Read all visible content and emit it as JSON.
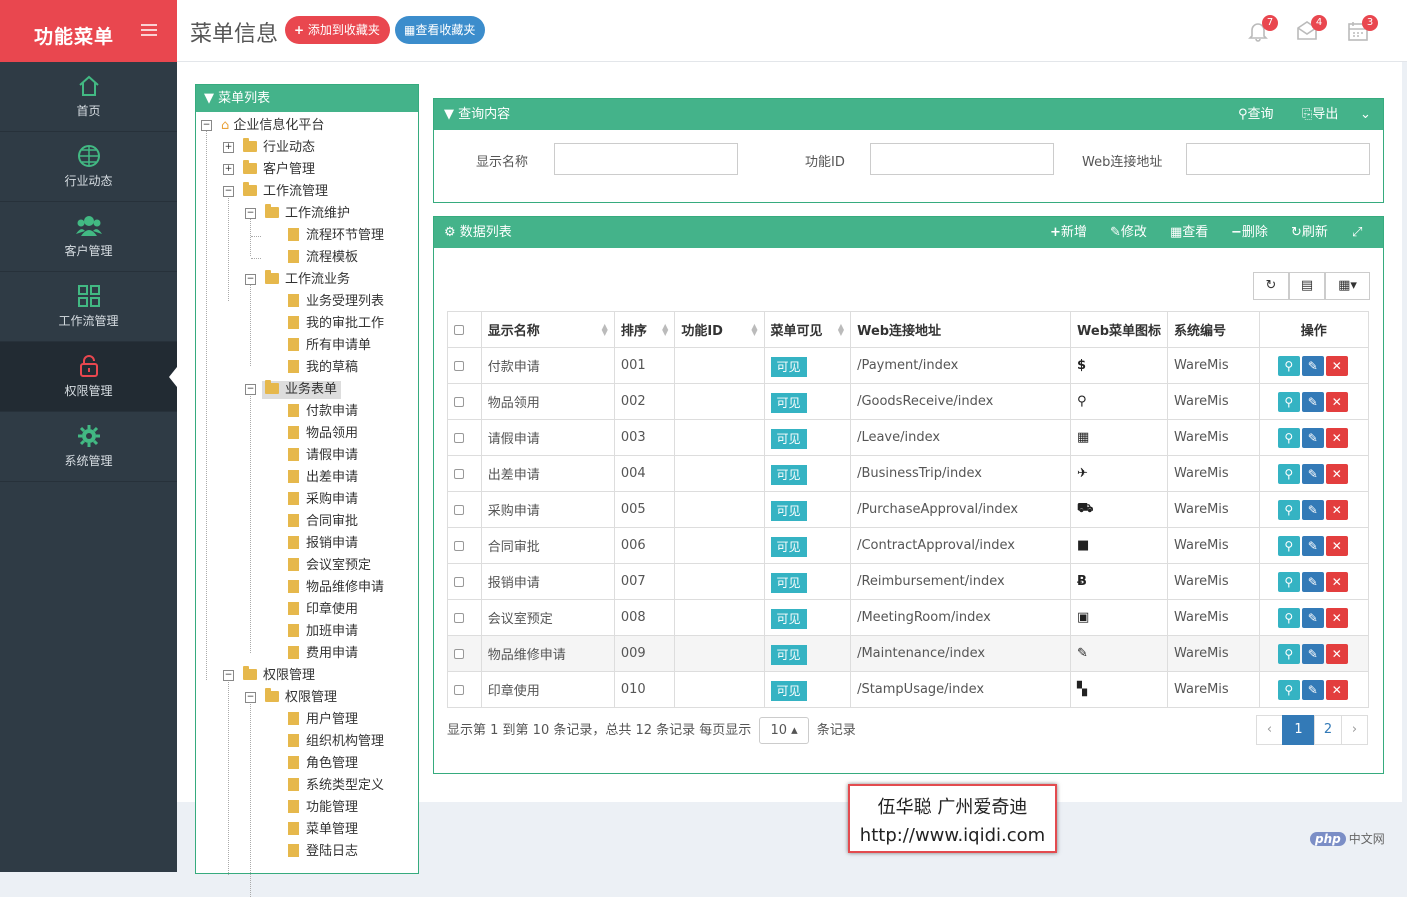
{
  "sidebar": {
    "logo": "功能菜单",
    "items": [
      {
        "label": "首页",
        "icon": "home-icon"
      },
      {
        "label": "行业动态",
        "icon": "globe-icon"
      },
      {
        "label": "客户管理",
        "icon": "users-icon"
      },
      {
        "label": "工作流管理",
        "icon": "grid-icon"
      },
      {
        "label": "权限管理",
        "icon": "lock-icon"
      },
      {
        "label": "系统管理",
        "icon": "gear-icon"
      }
    ]
  },
  "header": {
    "title": "菜单信息",
    "add_fav": "添加到收藏夹",
    "view_fav": "查看收藏夹",
    "notifications": [
      {
        "icon": "bell-icon",
        "count": "7"
      },
      {
        "icon": "envelope-icon",
        "count": "4"
      },
      {
        "icon": "calendar-icon",
        "count": "3"
      }
    ]
  },
  "tree": {
    "title": "菜单列表",
    "root": "企业信息化平台",
    "n1": "行业动态",
    "n2": "客户管理",
    "n3": "工作流管理",
    "n3a": "工作流维护",
    "n3a1": "流程环节管理",
    "n3a2": "流程模板",
    "n3b": "工作流业务",
    "n3b1": "业务受理列表",
    "n3b2": "我的审批工作",
    "n3b3": "所有申请单",
    "n3b4": "我的草稿",
    "n3c": "业务表单",
    "n3c1": "付款申请",
    "n3c2": "物品领用",
    "n3c3": "请假申请",
    "n3c4": "出差申请",
    "n3c5": "采购申请",
    "n3c6": "合同审批",
    "n3c7": "报销申请",
    "n3c8": "会议室预定",
    "n3c9": "物品维修申请",
    "n3c10": "印章使用",
    "n3c11": "加班申请",
    "n3c12": "费用申请",
    "n4": "权限管理",
    "n4a": "权限管理",
    "n4a1": "用户管理",
    "n4a2": "组织机构管理",
    "n4a3": "角色管理",
    "n4a4": "系统类型定义",
    "n4a5": "功能管理",
    "n4a6": "菜单管理",
    "n4a7": "登陆日志"
  },
  "query": {
    "title": "查询内容",
    "search": "查询",
    "export": "导出",
    "label_name": "显示名称",
    "label_id": "功能ID",
    "label_url": "Web连接地址",
    "value_name": "",
    "value_id": "",
    "value_url": ""
  },
  "grid": {
    "title": "数据列表",
    "add": "新增",
    "edit": "修改",
    "view": "查看",
    "delete": "删除",
    "refresh": "刷新",
    "columns": [
      "显示名称",
      "排序",
      "功能ID",
      "菜单可见",
      "Web连接地址",
      "Web菜单图标",
      "系统编号",
      "操作"
    ],
    "rows": [
      {
        "name": "付款申请",
        "order": "001",
        "fid": "",
        "visible": "可见",
        "url": "/Payment/index",
        "icon": "$",
        "sys": "WareMis"
      },
      {
        "name": "物品领用",
        "order": "002",
        "fid": "",
        "visible": "可见",
        "url": "/GoodsReceive/index",
        "icon": "⚲",
        "sys": "WareMis"
      },
      {
        "name": "请假申请",
        "order": "003",
        "fid": "",
        "visible": "可见",
        "url": "/Leave/index",
        "icon": "▦",
        "sys": "WareMis"
      },
      {
        "name": "出差申请",
        "order": "004",
        "fid": "",
        "visible": "可见",
        "url": "/BusinessTrip/index",
        "icon": "✈",
        "sys": "WareMis"
      },
      {
        "name": "采购申请",
        "order": "005",
        "fid": "",
        "visible": "可见",
        "url": "/PurchaseApproval/index",
        "icon": "⛟",
        "sys": "WareMis"
      },
      {
        "name": "合同审批",
        "order": "006",
        "fid": "",
        "visible": "可见",
        "url": "/ContractApproval/index",
        "icon": "■",
        "sys": "WareMis"
      },
      {
        "name": "报销申请",
        "order": "007",
        "fid": "",
        "visible": "可见",
        "url": "/Reimbursement/index",
        "icon": "Ƀ",
        "sys": "WareMis"
      },
      {
        "name": "会议室预定",
        "order": "008",
        "fid": "",
        "visible": "可见",
        "url": "/MeetingRoom/index",
        "icon": "▣",
        "sys": "WareMis"
      },
      {
        "name": "物品维修申请",
        "order": "009",
        "fid": "",
        "visible": "可见",
        "url": "/Maintenance/index",
        "icon": "✎",
        "sys": "WareMis"
      },
      {
        "name": "印章使用",
        "order": "010",
        "fid": "",
        "visible": "可见",
        "url": "/StampUsage/index",
        "icon": "▚",
        "sys": "WareMis"
      }
    ],
    "footer_text": "显示第 1 到第 10 条记录，总共 12 条记录 每页显示",
    "page_size": "10",
    "footer_suffix": "条记录",
    "pages": [
      "‹",
      "1",
      "2",
      "›"
    ]
  },
  "watermark": {
    "line1": "伍华聪 广州爱奇迪",
    "line2": "http://www.iqidi.com"
  },
  "corner": {
    "logo": "php",
    "text": "中文网"
  },
  "colors": {
    "brand": "#e9474f",
    "accent": "#44b38a",
    "sidebar": "#2f3b45",
    "info": "#35b3c3",
    "primary": "#337ab7",
    "danger": "#e33e3e"
  }
}
